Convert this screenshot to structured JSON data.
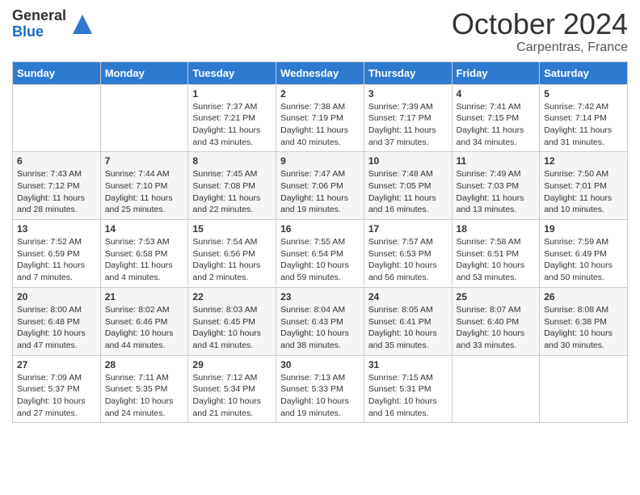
{
  "header": {
    "logo_general": "General",
    "logo_blue": "Blue",
    "month": "October 2024",
    "location": "Carpentras, France"
  },
  "weekdays": [
    "Sunday",
    "Monday",
    "Tuesday",
    "Wednesday",
    "Thursday",
    "Friday",
    "Saturday"
  ],
  "weeks": [
    [
      {
        "day": "",
        "info": ""
      },
      {
        "day": "",
        "info": ""
      },
      {
        "day": "1",
        "info": "Sunrise: 7:37 AM\nSunset: 7:21 PM\nDaylight: 11 hours and 43 minutes."
      },
      {
        "day": "2",
        "info": "Sunrise: 7:38 AM\nSunset: 7:19 PM\nDaylight: 11 hours and 40 minutes."
      },
      {
        "day": "3",
        "info": "Sunrise: 7:39 AM\nSunset: 7:17 PM\nDaylight: 11 hours and 37 minutes."
      },
      {
        "day": "4",
        "info": "Sunrise: 7:41 AM\nSunset: 7:15 PM\nDaylight: 11 hours and 34 minutes."
      },
      {
        "day": "5",
        "info": "Sunrise: 7:42 AM\nSunset: 7:14 PM\nDaylight: 11 hours and 31 minutes."
      }
    ],
    [
      {
        "day": "6",
        "info": "Sunrise: 7:43 AM\nSunset: 7:12 PM\nDaylight: 11 hours and 28 minutes."
      },
      {
        "day": "7",
        "info": "Sunrise: 7:44 AM\nSunset: 7:10 PM\nDaylight: 11 hours and 25 minutes."
      },
      {
        "day": "8",
        "info": "Sunrise: 7:45 AM\nSunset: 7:08 PM\nDaylight: 11 hours and 22 minutes."
      },
      {
        "day": "9",
        "info": "Sunrise: 7:47 AM\nSunset: 7:06 PM\nDaylight: 11 hours and 19 minutes."
      },
      {
        "day": "10",
        "info": "Sunrise: 7:48 AM\nSunset: 7:05 PM\nDaylight: 11 hours and 16 minutes."
      },
      {
        "day": "11",
        "info": "Sunrise: 7:49 AM\nSunset: 7:03 PM\nDaylight: 11 hours and 13 minutes."
      },
      {
        "day": "12",
        "info": "Sunrise: 7:50 AM\nSunset: 7:01 PM\nDaylight: 11 hours and 10 minutes."
      }
    ],
    [
      {
        "day": "13",
        "info": "Sunrise: 7:52 AM\nSunset: 6:59 PM\nDaylight: 11 hours and 7 minutes."
      },
      {
        "day": "14",
        "info": "Sunrise: 7:53 AM\nSunset: 6:58 PM\nDaylight: 11 hours and 4 minutes."
      },
      {
        "day": "15",
        "info": "Sunrise: 7:54 AM\nSunset: 6:56 PM\nDaylight: 11 hours and 2 minutes."
      },
      {
        "day": "16",
        "info": "Sunrise: 7:55 AM\nSunset: 6:54 PM\nDaylight: 10 hours and 59 minutes."
      },
      {
        "day": "17",
        "info": "Sunrise: 7:57 AM\nSunset: 6:53 PM\nDaylight: 10 hours and 56 minutes."
      },
      {
        "day": "18",
        "info": "Sunrise: 7:58 AM\nSunset: 6:51 PM\nDaylight: 10 hours and 53 minutes."
      },
      {
        "day": "19",
        "info": "Sunrise: 7:59 AM\nSunset: 6:49 PM\nDaylight: 10 hours and 50 minutes."
      }
    ],
    [
      {
        "day": "20",
        "info": "Sunrise: 8:00 AM\nSunset: 6:48 PM\nDaylight: 10 hours and 47 minutes."
      },
      {
        "day": "21",
        "info": "Sunrise: 8:02 AM\nSunset: 6:46 PM\nDaylight: 10 hours and 44 minutes."
      },
      {
        "day": "22",
        "info": "Sunrise: 8:03 AM\nSunset: 6:45 PM\nDaylight: 10 hours and 41 minutes."
      },
      {
        "day": "23",
        "info": "Sunrise: 8:04 AM\nSunset: 6:43 PM\nDaylight: 10 hours and 38 minutes."
      },
      {
        "day": "24",
        "info": "Sunrise: 8:05 AM\nSunset: 6:41 PM\nDaylight: 10 hours and 35 minutes."
      },
      {
        "day": "25",
        "info": "Sunrise: 8:07 AM\nSunset: 6:40 PM\nDaylight: 10 hours and 33 minutes."
      },
      {
        "day": "26",
        "info": "Sunrise: 8:08 AM\nSunset: 6:38 PM\nDaylight: 10 hours and 30 minutes."
      }
    ],
    [
      {
        "day": "27",
        "info": "Sunrise: 7:09 AM\nSunset: 5:37 PM\nDaylight: 10 hours and 27 minutes."
      },
      {
        "day": "28",
        "info": "Sunrise: 7:11 AM\nSunset: 5:35 PM\nDaylight: 10 hours and 24 minutes."
      },
      {
        "day": "29",
        "info": "Sunrise: 7:12 AM\nSunset: 5:34 PM\nDaylight: 10 hours and 21 minutes."
      },
      {
        "day": "30",
        "info": "Sunrise: 7:13 AM\nSunset: 5:33 PM\nDaylight: 10 hours and 19 minutes."
      },
      {
        "day": "31",
        "info": "Sunrise: 7:15 AM\nSunset: 5:31 PM\nDaylight: 10 hours and 16 minutes."
      },
      {
        "day": "",
        "info": ""
      },
      {
        "day": "",
        "info": ""
      }
    ]
  ]
}
